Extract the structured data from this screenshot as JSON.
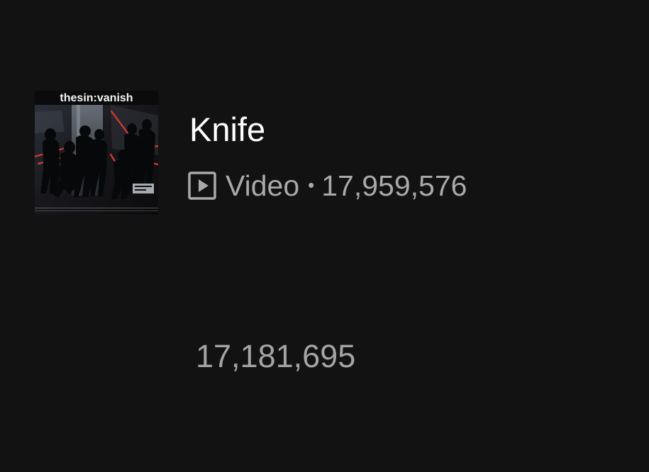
{
  "track": {
    "title": "Knife",
    "type_label": "Video",
    "separator": "•",
    "plays": "17,959,576",
    "thumbnail_title": "thesin:vanish",
    "thumbnail_icon": "album-artwork"
  },
  "footer": {
    "count": "17,181,695"
  },
  "colors": {
    "background": "#121212",
    "title": "#ffffff",
    "meta": "#a9a9a9",
    "count": "#a4a4a4",
    "laser": "#e33b35"
  },
  "icons": {
    "video": "video-icon"
  }
}
